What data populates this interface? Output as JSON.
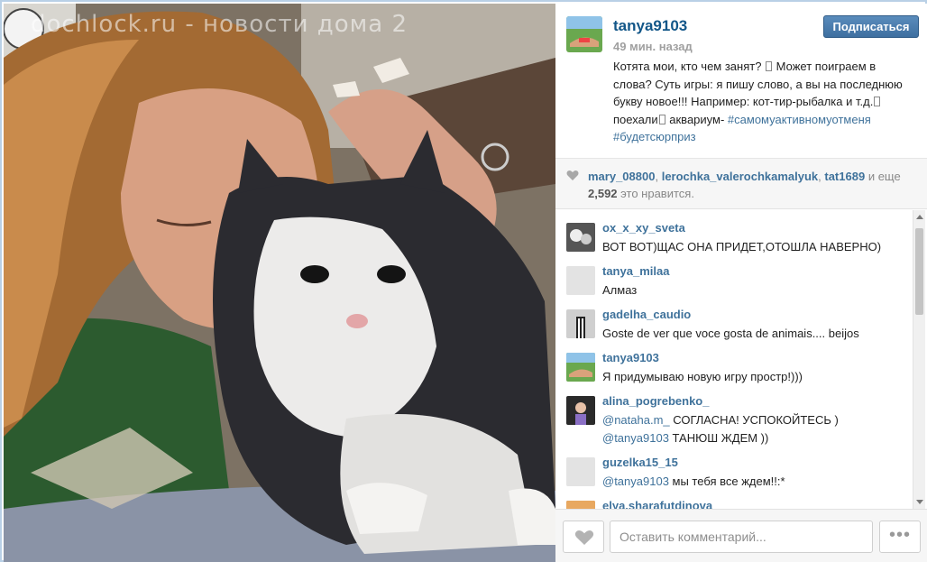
{
  "photo": {
    "watermark": "dochlock.ru - новости дома 2"
  },
  "post": {
    "owner": "tanya9103",
    "follow_label": "Подписаться",
    "time": "49 мин. назад",
    "caption_part1": "Котята мои, кто чем занят? ",
    "caption_part2": " Может поиграем в слова? Суть игры: я пишу слово, а вы на последнюю букву новое!!! Например: кот-тир-рыбалка и т.д.",
    "caption_part3": " поехали",
    "caption_part4": " аквариум-",
    "hashtags": "#самомуактивномуотменя #будетсюрприз"
  },
  "likes": {
    "user1": "mary_08800",
    "user2": "lerochka_valerochkamalyuk",
    "user3": "tat1689",
    "and_text": "и",
    "more_text": "еще",
    "count": "2,592",
    "suffix": "это нравится."
  },
  "comments": [
    {
      "user": "ox_x_xy_sveta",
      "text": "ВОТ ВОТ)ЩАС ОНА ПРИДЕТ,ОТОШЛА НАВЕРНО)"
    },
    {
      "user": "tanya_milaa",
      "text": "Алмаз"
    },
    {
      "user": "gadelha_caudio",
      "text": "Goste de ver que voce gosta de animais.... beijos"
    },
    {
      "user": "tanya9103",
      "text": "Я придумываю новую игру простр!)))"
    },
    {
      "user": "alina_pogrebenko_",
      "mention1": "@nataha.m_",
      "text1": " СОГЛАСНА! УСПОКОЙТЕСЬ )",
      "mention2": "@tanya9103",
      "text2": " ТАНЮШ ЖДЕМ ))"
    },
    {
      "user": "guzelka15_15",
      "mention": "@tanya9103",
      "text": " мы тебя все ждем!!:*"
    },
    {
      "user": "elya.sharafutdinova"
    }
  ],
  "footer": {
    "comment_placeholder": "Оставить комментарий...",
    "more_label": "•••"
  },
  "colors": {
    "link": "#3f729b",
    "username_header": "#125688",
    "follow_button": "#4a7cae"
  }
}
